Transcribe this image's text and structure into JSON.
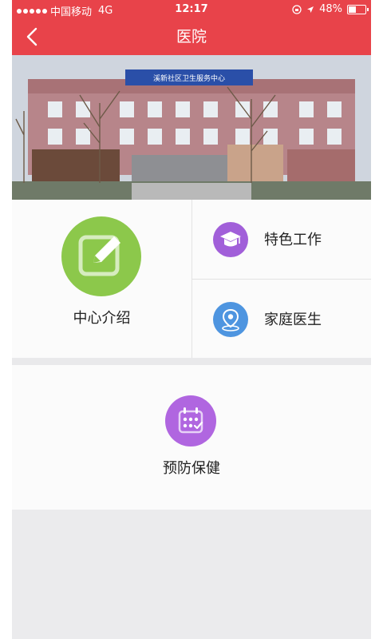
{
  "status_bar": {
    "carrier": "中国移动",
    "network": "4G",
    "time": "12:17",
    "battery": "48%",
    "battery_level": 0.48
  },
  "nav": {
    "title": "医院",
    "back_icon": "chevron-left-icon"
  },
  "hero": {
    "sign_text": "溪新社区卫生服务中心"
  },
  "features": {
    "center_intro": {
      "label": "中心介绍",
      "icon": "edit-icon",
      "color": "#8cc84b"
    },
    "special_work": {
      "label": "特色工作",
      "icon": "graduation-cap-icon",
      "color": "#a15fd9"
    },
    "family_doctor": {
      "label": "家庭医生",
      "icon": "location-pin-icon",
      "color": "#4e95e0"
    },
    "preventive_care": {
      "label": "预防保健",
      "icon": "calendar-check-icon",
      "color": "#b066e0"
    }
  },
  "colors": {
    "header": "#e8434a",
    "background": "#ebebed"
  }
}
